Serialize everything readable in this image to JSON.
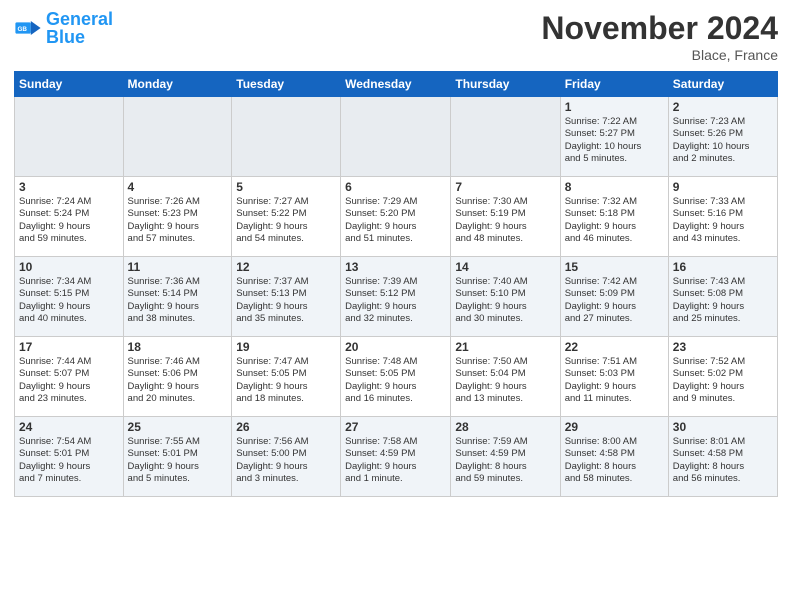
{
  "header": {
    "logo_general": "General",
    "logo_blue": "Blue",
    "month": "November 2024",
    "location": "Blace, France"
  },
  "weekdays": [
    "Sunday",
    "Monday",
    "Tuesday",
    "Wednesday",
    "Thursday",
    "Friday",
    "Saturday"
  ],
  "weeks": [
    [
      {
        "day": "",
        "info": ""
      },
      {
        "day": "",
        "info": ""
      },
      {
        "day": "",
        "info": ""
      },
      {
        "day": "",
        "info": ""
      },
      {
        "day": "",
        "info": ""
      },
      {
        "day": "1",
        "info": "Sunrise: 7:22 AM\nSunset: 5:27 PM\nDaylight: 10 hours\nand 5 minutes."
      },
      {
        "day": "2",
        "info": "Sunrise: 7:23 AM\nSunset: 5:26 PM\nDaylight: 10 hours\nand 2 minutes."
      }
    ],
    [
      {
        "day": "3",
        "info": "Sunrise: 7:24 AM\nSunset: 5:24 PM\nDaylight: 9 hours\nand 59 minutes."
      },
      {
        "day": "4",
        "info": "Sunrise: 7:26 AM\nSunset: 5:23 PM\nDaylight: 9 hours\nand 57 minutes."
      },
      {
        "day": "5",
        "info": "Sunrise: 7:27 AM\nSunset: 5:22 PM\nDaylight: 9 hours\nand 54 minutes."
      },
      {
        "day": "6",
        "info": "Sunrise: 7:29 AM\nSunset: 5:20 PM\nDaylight: 9 hours\nand 51 minutes."
      },
      {
        "day": "7",
        "info": "Sunrise: 7:30 AM\nSunset: 5:19 PM\nDaylight: 9 hours\nand 48 minutes."
      },
      {
        "day": "8",
        "info": "Sunrise: 7:32 AM\nSunset: 5:18 PM\nDaylight: 9 hours\nand 46 minutes."
      },
      {
        "day": "9",
        "info": "Sunrise: 7:33 AM\nSunset: 5:16 PM\nDaylight: 9 hours\nand 43 minutes."
      }
    ],
    [
      {
        "day": "10",
        "info": "Sunrise: 7:34 AM\nSunset: 5:15 PM\nDaylight: 9 hours\nand 40 minutes."
      },
      {
        "day": "11",
        "info": "Sunrise: 7:36 AM\nSunset: 5:14 PM\nDaylight: 9 hours\nand 38 minutes."
      },
      {
        "day": "12",
        "info": "Sunrise: 7:37 AM\nSunset: 5:13 PM\nDaylight: 9 hours\nand 35 minutes."
      },
      {
        "day": "13",
        "info": "Sunrise: 7:39 AM\nSunset: 5:12 PM\nDaylight: 9 hours\nand 32 minutes."
      },
      {
        "day": "14",
        "info": "Sunrise: 7:40 AM\nSunset: 5:10 PM\nDaylight: 9 hours\nand 30 minutes."
      },
      {
        "day": "15",
        "info": "Sunrise: 7:42 AM\nSunset: 5:09 PM\nDaylight: 9 hours\nand 27 minutes."
      },
      {
        "day": "16",
        "info": "Sunrise: 7:43 AM\nSunset: 5:08 PM\nDaylight: 9 hours\nand 25 minutes."
      }
    ],
    [
      {
        "day": "17",
        "info": "Sunrise: 7:44 AM\nSunset: 5:07 PM\nDaylight: 9 hours\nand 23 minutes."
      },
      {
        "day": "18",
        "info": "Sunrise: 7:46 AM\nSunset: 5:06 PM\nDaylight: 9 hours\nand 20 minutes."
      },
      {
        "day": "19",
        "info": "Sunrise: 7:47 AM\nSunset: 5:05 PM\nDaylight: 9 hours\nand 18 minutes."
      },
      {
        "day": "20",
        "info": "Sunrise: 7:48 AM\nSunset: 5:05 PM\nDaylight: 9 hours\nand 16 minutes."
      },
      {
        "day": "21",
        "info": "Sunrise: 7:50 AM\nSunset: 5:04 PM\nDaylight: 9 hours\nand 13 minutes."
      },
      {
        "day": "22",
        "info": "Sunrise: 7:51 AM\nSunset: 5:03 PM\nDaylight: 9 hours\nand 11 minutes."
      },
      {
        "day": "23",
        "info": "Sunrise: 7:52 AM\nSunset: 5:02 PM\nDaylight: 9 hours\nand 9 minutes."
      }
    ],
    [
      {
        "day": "24",
        "info": "Sunrise: 7:54 AM\nSunset: 5:01 PM\nDaylight: 9 hours\nand 7 minutes."
      },
      {
        "day": "25",
        "info": "Sunrise: 7:55 AM\nSunset: 5:01 PM\nDaylight: 9 hours\nand 5 minutes."
      },
      {
        "day": "26",
        "info": "Sunrise: 7:56 AM\nSunset: 5:00 PM\nDaylight: 9 hours\nand 3 minutes."
      },
      {
        "day": "27",
        "info": "Sunrise: 7:58 AM\nSunset: 4:59 PM\nDaylight: 9 hours\nand 1 minute."
      },
      {
        "day": "28",
        "info": "Sunrise: 7:59 AM\nSunset: 4:59 PM\nDaylight: 8 hours\nand 59 minutes."
      },
      {
        "day": "29",
        "info": "Sunrise: 8:00 AM\nSunset: 4:58 PM\nDaylight: 8 hours\nand 58 minutes."
      },
      {
        "day": "30",
        "info": "Sunrise: 8:01 AM\nSunset: 4:58 PM\nDaylight: 8 hours\nand 56 minutes."
      }
    ]
  ]
}
